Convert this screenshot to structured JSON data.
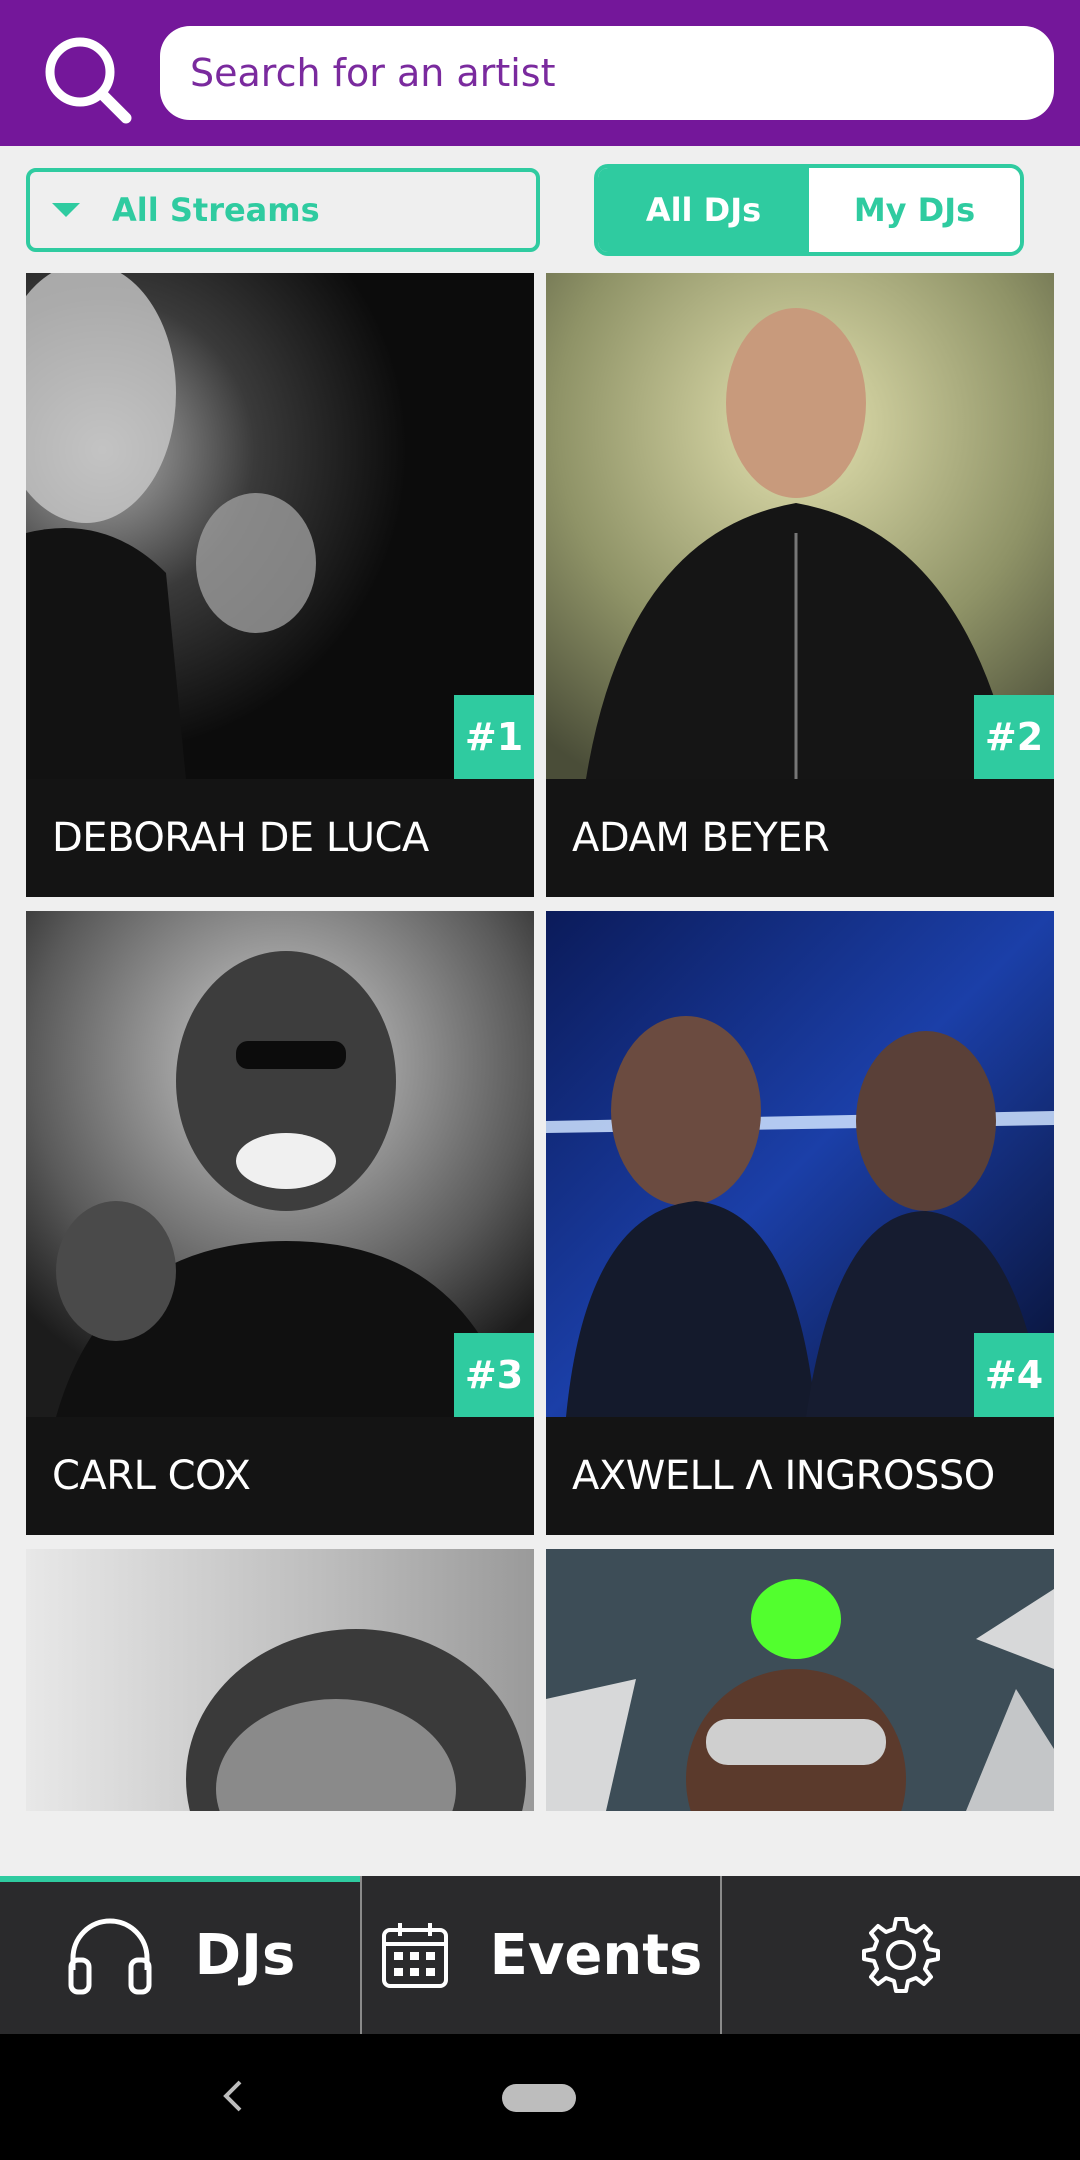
{
  "search": {
    "placeholder": "Search for an artist"
  },
  "filter": {
    "stream_label": "All Streams",
    "segments": [
      {
        "label": "All DJs",
        "active": true
      },
      {
        "label": "My DJs",
        "active": false
      }
    ]
  },
  "djs": [
    {
      "name": "DEBORAH DE LUCA",
      "rank": "#1"
    },
    {
      "name": "ADAM BEYER",
      "rank": "#2"
    },
    {
      "name": "CARL COX",
      "rank": "#3"
    },
    {
      "name": "AXWELL Λ INGROSSO",
      "rank": "#4"
    }
  ],
  "nav": {
    "djs_label": "DJs",
    "events_label": "Events",
    "settings_icon": "gear-icon"
  },
  "colors": {
    "brand_purple": "#74179a",
    "accent_teal": "#2fcba0",
    "nav_bg": "#2a2a2c"
  }
}
